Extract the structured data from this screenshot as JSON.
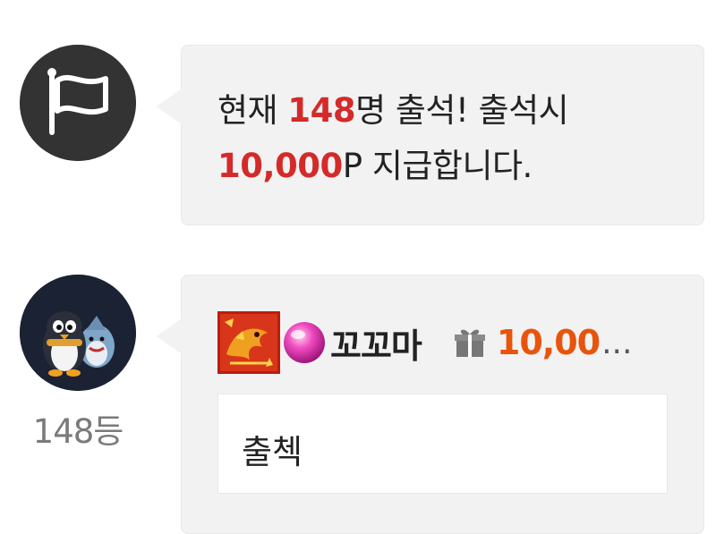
{
  "notice": {
    "icon": "flag-icon",
    "prefix": "현재 ",
    "count": "148",
    "suffix_line1": "명 출석! 출석시",
    "amount": "10,000",
    "suffix_line2": "P 지급합니다."
  },
  "comment": {
    "avatar_icon": "penguin-avatar",
    "badges": [
      "dragon-badge-icon",
      "pink-orb-badge-icon"
    ],
    "username": "꼬꼬마",
    "gift_icon": "gift-icon",
    "gift_amount": "10,00",
    "gift_ellipsis": "...",
    "body": "출첵",
    "rank": "148등"
  },
  "colors": {
    "highlight_red": "#d42a2a",
    "gift_orange": "#e8540c",
    "bubble_bg": "#f2f2f2",
    "avatar_dark": "#333333"
  }
}
